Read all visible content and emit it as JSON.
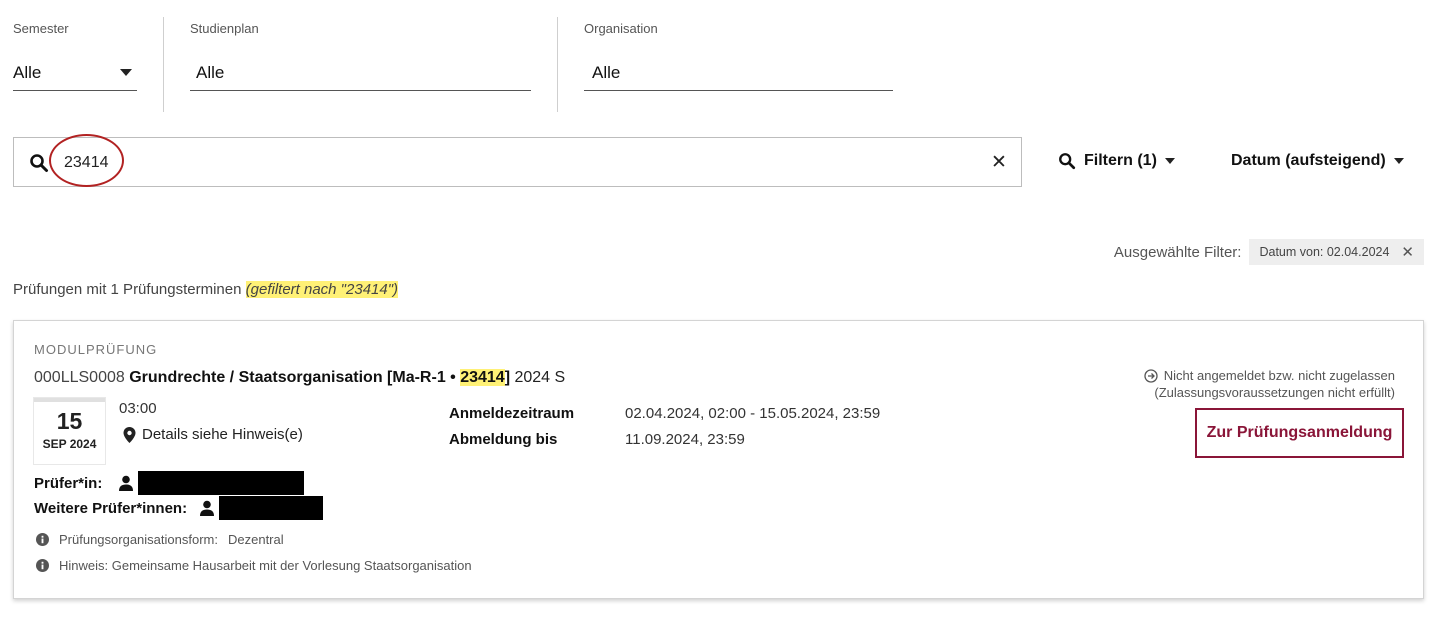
{
  "filters": {
    "semester": {
      "label": "Semester",
      "value": "Alle"
    },
    "studienplan": {
      "label": "Studienplan",
      "value": "Alle"
    },
    "organisation": {
      "label": "Organisation",
      "value": "Alle"
    }
  },
  "search": {
    "value": "23414",
    "placeholder": ""
  },
  "toolbar": {
    "filter_label": "Filtern (1)",
    "sort_label": "Datum (aufsteigend)"
  },
  "selected_filters": {
    "label": "Ausgewählte Filter:",
    "chips": [
      {
        "label": "Datum von: 02.04.2024"
      }
    ]
  },
  "results": {
    "summary": "Prüfungen mit 1 Prüfungsterminen",
    "filtered_note": "(gefiltert nach \"23414\")"
  },
  "exam": {
    "type": "MODULPRÜFUNG",
    "code": "000LLS0008",
    "title_prefix": "Grundrechte / Staatsorganisation [Ma-R-1 • ",
    "title_highlight": "23414",
    "title_suffix": "]",
    "term": "2024 S",
    "date_day": "15",
    "date_month": "SEP 2024",
    "time": "03:00",
    "location": "Details siehe Hinweis(e)",
    "registration_period_label": "Anmeldezeitraum",
    "registration_period_value": "02.04.2024, 02:00 - 15.05.2024, 23:59",
    "deregistration_label": "Abmeldung bis",
    "deregistration_value": "11.09.2024, 23:59",
    "examiner_label": "Prüfer*in:",
    "further_examiners_label": "Weitere Prüfer*innen:",
    "org_form_label": "Prüfungsorganisationsform:",
    "org_form_value": "Dezentral",
    "hint": "Hinweis: Gemeinsame Hausarbeit mit der Vorlesung Staatsorganisation",
    "status_line1": "Nicht angemeldet bzw. nicht zugelassen",
    "status_line2": "(Zulassungsvoraussetzungen nicht erfüllt)",
    "register_button": "Zur Prüfungsanmeldung"
  },
  "colors": {
    "accent": "#8a1538",
    "highlight": "#fff176",
    "annotation_circle": "#b22222"
  },
  "icons": {
    "search": "search-icon",
    "clear": "close-icon",
    "location": "map-marker-icon",
    "person": "person-icon",
    "info": "info-circle-icon",
    "status": "arrow-circle-right-icon",
    "caret": "caret-down-icon"
  }
}
